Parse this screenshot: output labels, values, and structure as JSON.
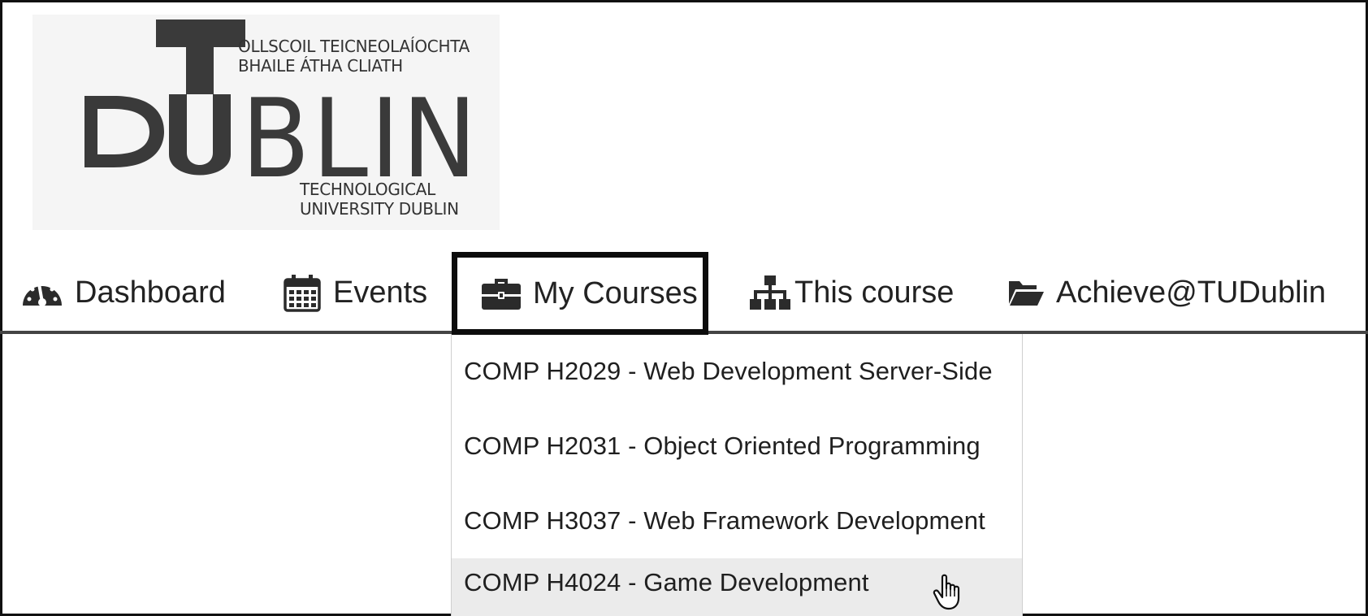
{
  "logo": {
    "line1": "OLLSCOIL TEICNEOLAÍOCHTA",
    "line2": "BHAILE ÁTHA CLIATH",
    "big_t": "T",
    "big_d": "D",
    "big_u": "U",
    "big_rest": "BLIN",
    "line3": "TECHNOLOGICAL",
    "line4": "UNIVERSITY DUBLIN"
  },
  "nav": {
    "items": [
      {
        "label": "Dashboard",
        "icon": "dashboard-gauge-icon"
      },
      {
        "label": "Events",
        "icon": "calendar-icon"
      },
      {
        "label": "My Courses",
        "icon": "briefcase-icon"
      },
      {
        "label": "This course",
        "icon": "sitemap-icon"
      },
      {
        "label": "Achieve@TUDublin",
        "icon": "folder-open-icon"
      }
    ]
  },
  "dropdown": {
    "items": [
      {
        "label": "COMP H2029 - Web Development Server-Side"
      },
      {
        "label": "COMP H2031 - Object Oriented Programming"
      },
      {
        "label": "COMP H3037 - Web Framework Development"
      },
      {
        "label": "COMP H4024 - Game Development",
        "hovered": true
      }
    ]
  },
  "colors": {
    "text": "#1e1e1e",
    "hover_bg": "#ebebeb",
    "highlight_border": "#0c0c0c"
  }
}
